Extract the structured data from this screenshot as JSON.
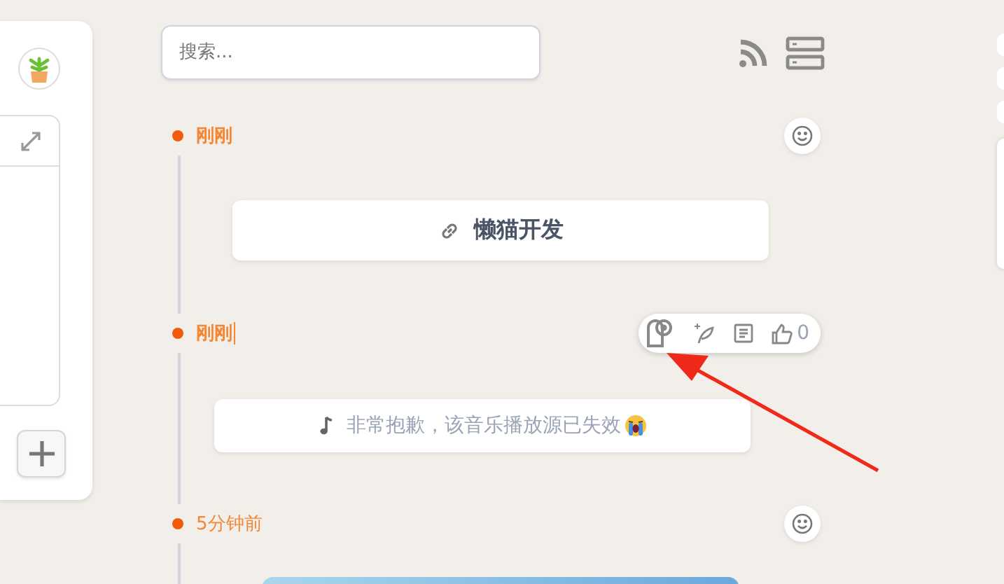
{
  "search": {
    "placeholder": "搜索..."
  },
  "timeline": [
    {
      "time": "刚刚",
      "recent": true,
      "cursor": false,
      "header": {
        "kind": "reaction"
      },
      "card": {
        "kind": "link",
        "text": "懒猫开发"
      }
    },
    {
      "time": "刚刚",
      "recent": true,
      "cursor": true,
      "header": {
        "kind": "toolbar",
        "like_count": "0"
      },
      "card": {
        "kind": "music",
        "text": "非常抱歉，该音乐播放源已失效"
      }
    },
    {
      "time": "5分钟前",
      "recent": false,
      "cursor": false,
      "header": {
        "kind": "reaction"
      }
    }
  ]
}
